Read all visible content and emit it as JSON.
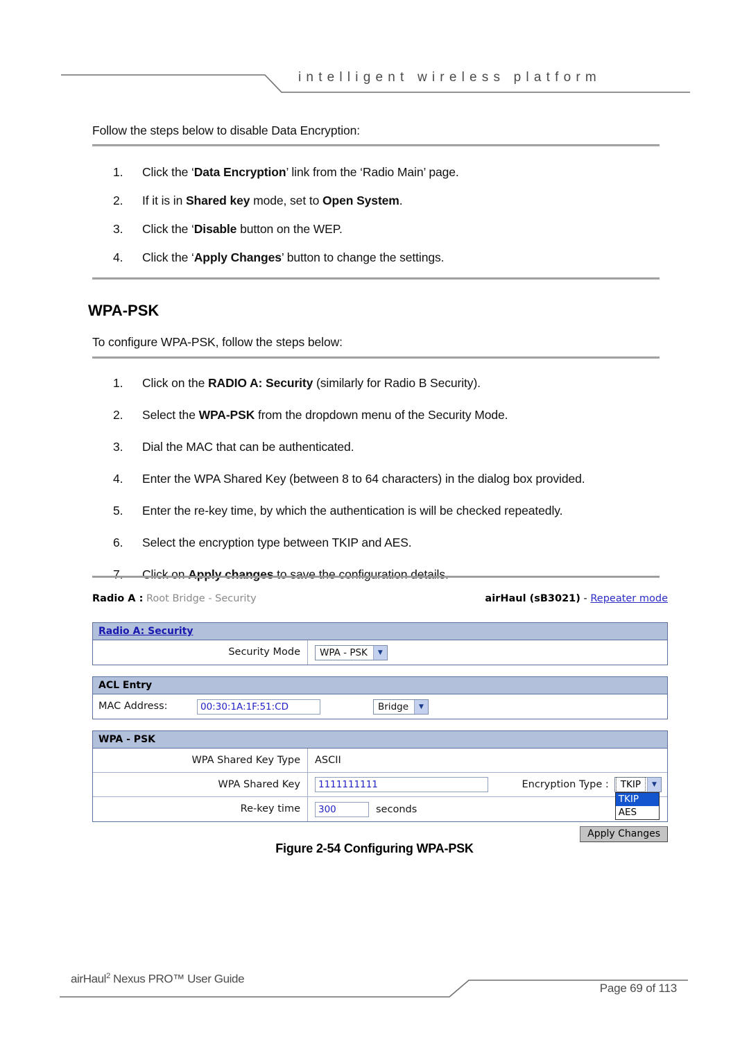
{
  "header": {
    "tagline": "intelligent  wireless  platform"
  },
  "body": {
    "intro": "Follow the steps below to disable Data Encryption:",
    "steps_disable": [
      {
        "num": "1.",
        "html": "Click the &lsquo;<b class='bold'>Data Encryption</b>&rsquo; link from the &lsquo;Radio Main&rsquo; page."
      },
      {
        "num": "2.",
        "html": "If it is in <b class='bold'>Shared key</b> mode, set to <b class='bold'>Open System</b>."
      },
      {
        "num": "3.",
        "html": "Click the &lsquo;<b class='bold'>Disable</b> button on the WEP."
      },
      {
        "num": "4.",
        "html": "Click the &lsquo;<b class='bold'>Apply Changes</b>&rsquo; button to change the settings."
      }
    ],
    "section_heading": "WPA-PSK",
    "section_intro": "To configure WPA-PSK, follow the steps below:",
    "steps_wpa": [
      {
        "num": "1.",
        "html": "Click on the <b class='bold'>RADIO A: Security</b> (similarly for Radio B Security)."
      },
      {
        "num": "2.",
        "html": "Select the <b class='bold'>WPA-PSK</b> from the dropdown menu of the Security Mode."
      },
      {
        "num": "3.",
        "html": "Dial the MAC that can be authenticated."
      },
      {
        "num": "4.",
        "html": "Enter the WPA Shared Key (between 8 to 64 characters) in the dialog box provided."
      },
      {
        "num": "5.",
        "html": "Enter the re-key time, by which the authentication is will be checked repeatedly."
      },
      {
        "num": "6.",
        "html": "Select the encryption type between TKIP and AES."
      },
      {
        "num": "7.",
        "html": "Click on <b class='bold'>Apply changes</b> to save the configuration details."
      }
    ]
  },
  "router_ui": {
    "titlebar": {
      "left_bold": "Radio A :",
      "left_rest": " Root Bridge -  Security",
      "device": "airHaul (sB3021)",
      "separator": " - ",
      "mode_link": "Repeater mode"
    },
    "panel_security": {
      "header_link": "Radio A: Security",
      "row_label": "Security Mode",
      "select_value": "WPA - PSK",
      "select_options": [
        "WPA - PSK"
      ]
    },
    "panel_acl": {
      "header": "ACL Entry",
      "mac_label": "MAC Address:",
      "mac_value": "00:30:1A:1F:51:CD",
      "type_select_value": "Bridge",
      "type_select_options": [
        "Bridge"
      ]
    },
    "panel_wpa": {
      "header": "WPA - PSK",
      "key_type_label": "WPA Shared Key Type",
      "key_type_value": "ASCII",
      "shared_key_label": "WPA Shared Key",
      "shared_key_value": "1111111111",
      "encryption_label": "Encryption Type :",
      "encryption_value": "TKIP",
      "encryption_options": [
        "TKIP",
        "AES"
      ],
      "encryption_selected_index": 0,
      "rekey_label": "Re-key time",
      "rekey_value": "300",
      "rekey_unit": "seconds"
    },
    "apply_button": "Apply Changes"
  },
  "figure_caption": "Figure 2-54 Configuring WPA-PSK",
  "footer": {
    "left_pre": "airHaul",
    "left_sup": "2",
    "left_post": " Nexus PRO™ User Guide",
    "right": "Page 69 of 113"
  },
  "colors": {
    "panel_border": "#5b6f9c",
    "panel_header_bg": "#b2c0dc",
    "link_blue": "#1818b0",
    "input_text_blue": "#2222c8",
    "dropdown_highlight": "#1355cf",
    "rule_gray": "#a8a8a8"
  }
}
